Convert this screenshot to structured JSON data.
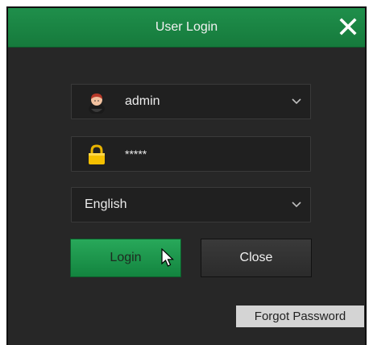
{
  "dialog": {
    "title": "User Login",
    "close_icon": "close-icon"
  },
  "form": {
    "username": {
      "value": "admin",
      "icon": "user-icon"
    },
    "password": {
      "value": "*****",
      "icon": "lock-icon"
    },
    "language": {
      "value": "English"
    }
  },
  "buttons": {
    "login_label": "Login",
    "close_label": "Close",
    "forgot_label": "Forgot Password"
  },
  "colors": {
    "accent": "#1f8f4b",
    "background": "#272727"
  }
}
